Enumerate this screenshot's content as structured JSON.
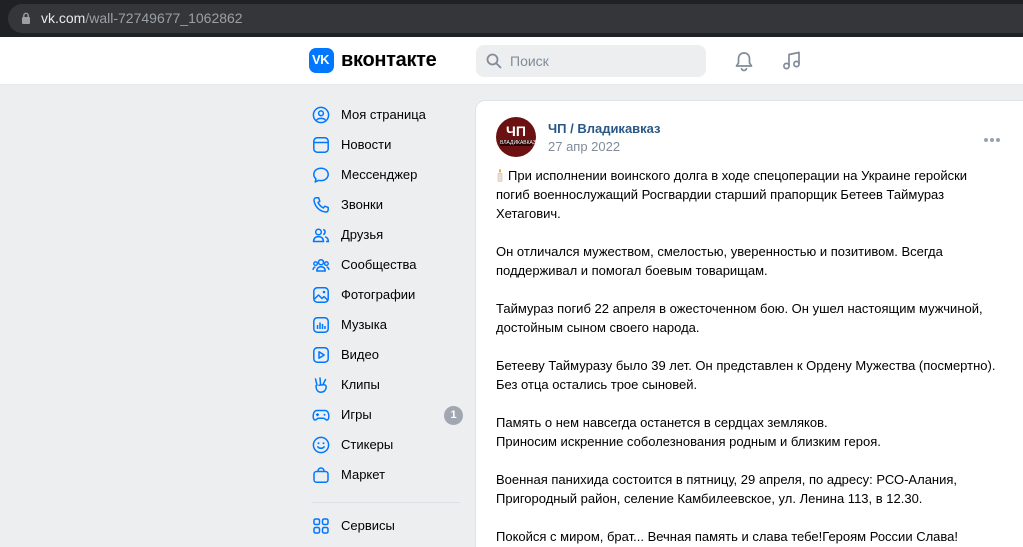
{
  "browser": {
    "url_domain": "vk.com",
    "url_path": "/wall-72749677_1062862"
  },
  "header": {
    "logo_text": "VK",
    "wordmark": "вконтакте",
    "search_placeholder": "Поиск"
  },
  "menu": {
    "items": [
      {
        "label": "Моя страница",
        "icon": "user-circle-icon"
      },
      {
        "label": "Новости",
        "icon": "newsfeed-icon"
      },
      {
        "label": "Мессенджер",
        "icon": "message-icon"
      },
      {
        "label": "Звонки",
        "icon": "phone-icon"
      },
      {
        "label": "Друзья",
        "icon": "friends-icon"
      },
      {
        "label": "Сообщества",
        "icon": "communities-icon"
      },
      {
        "label": "Фотографии",
        "icon": "photo-icon"
      },
      {
        "label": "Музыка",
        "icon": "music-icon"
      },
      {
        "label": "Видео",
        "icon": "video-icon"
      },
      {
        "label": "Клипы",
        "icon": "clips-icon"
      },
      {
        "label": "Игры",
        "icon": "gamepad-icon",
        "badge": "1"
      },
      {
        "label": "Стикеры",
        "icon": "smile-icon"
      },
      {
        "label": "Маркет",
        "icon": "bag-icon"
      }
    ],
    "services_label": "Сервисы"
  },
  "post": {
    "avatar_title": "ЧП",
    "avatar_subtitle": "ВЛАДИКАВКАЗ",
    "author": "ЧП / Владикавказ",
    "date": "27 апр 2022",
    "paragraphs": [
      [
        "При исполнении воинского долга в ходе спецоперации на Украине геройски",
        "погиб военнослужащий Росгвардии старший прапорщик Бетеев Таймураз",
        "Хетагович."
      ],
      [
        "Он отличался мужеством, смелостью, уверенностью и позитивом. Всегда",
        "поддерживал и помогал боевым товарищам."
      ],
      [
        "Таймураз погиб 22 апреля в ожесточенном бою. Он ушел настоящим мужчиной,",
        "достойным сыном своего народа."
      ],
      [
        "Бетееву Таймуразу было 39 лет. Он представлен к Ордену Мужества (посмертно).",
        "Без отца остались трое сыновей."
      ],
      [
        "Память о нем навсегда останется в сердцах земляков.",
        "Приносим искренние соболезнования родным и близким героя."
      ],
      [
        "Военная панихида состоится в пятницу, 29 апреля, по адресу: РСО-Алания,",
        "Пригородный район, селение Камбилеевское, ул. Ленина 113, в 12.30."
      ],
      [
        "Покойся с миром, брат... Вечная память и слава тебе!Героям России Слава!"
      ]
    ]
  },
  "colors": {
    "accent": "#0077ff",
    "link": "#2a5885",
    "secondary_text": "#818c99",
    "page_bg": "#edeef0"
  }
}
